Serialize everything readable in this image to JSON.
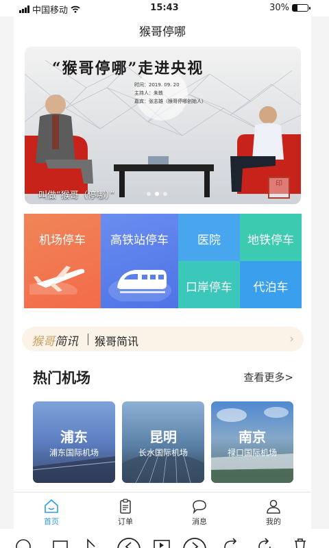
{
  "status_bar": {
    "carrier": "中国移动",
    "time": "15:43",
    "battery": "30%",
    "battery_level": 0.3
  },
  "header": {
    "title": "猴哥停哪"
  },
  "banner": {
    "headline": "“猴哥停哪”走进央视",
    "meta_lines": [
      "时间：2019. 09. 20",
      "主持人：朱轶",
      "嘉宾：张志雄（猴哥停哪创始人）"
    ],
    "caption": "叫做“猴哥（停哪）”",
    "seal_text": "印",
    "slide_count": 3,
    "active_slide": 1
  },
  "services": {
    "airport": "机场停车",
    "rail": "高铁站停车",
    "hospital": "医院",
    "metro": "地铁停车",
    "port": "口岸停车",
    "valet": "代泊车"
  },
  "news": {
    "brand_part1": "猴哥",
    "brand_part2": "简讯",
    "text": "猴哥简讯"
  },
  "airports_section": {
    "title": "热门机场",
    "more": "查看更多>",
    "cards": [
      {
        "city": "浦东",
        "airport": "浦东国际机场"
      },
      {
        "city": "昆明",
        "airport": "长水国际机场"
      },
      {
        "city": "南京",
        "airport": "禄口国际机场"
      }
    ]
  },
  "tabbar": {
    "home": "首页",
    "orders": "订单",
    "messages": "消息",
    "mine": "我的"
  },
  "colors": {
    "accent": "#2c9ae6",
    "airport_tile": "#f36b4a",
    "rail_tile": "#4d73e6",
    "hospital_tile": "#47a6ee",
    "metro_tile": "#3ccab0",
    "news_bg": "#fbf3e8"
  }
}
